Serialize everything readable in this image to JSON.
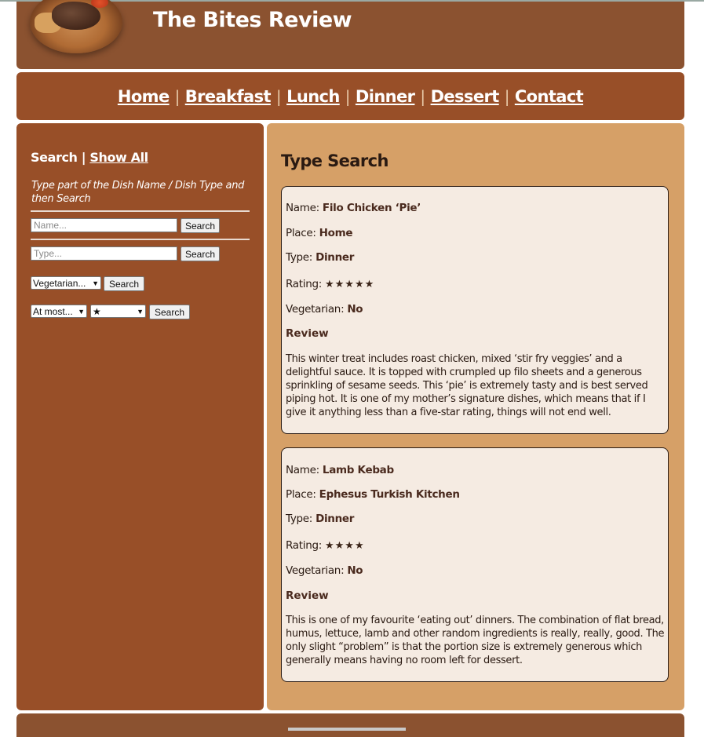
{
  "header": {
    "title": "The Bites Review",
    "logo_icon": "steak-dish-logo"
  },
  "nav": {
    "items": [
      "Home",
      "Breakfast",
      "Lunch",
      "Dinner",
      "Dessert",
      "Contact"
    ],
    "separator": "|"
  },
  "sidebar": {
    "search_label": "Search",
    "separator": "|",
    "show_all_label": "Show All",
    "help_text": "Type part of the Dish Name / Dish Type and then Search",
    "name_placeholder": "Name...",
    "type_placeholder": "Type...",
    "search_button": "Search",
    "vegetarian_select": "Vegetarian...",
    "rating_mode_select": "At most...",
    "rating_select": "★"
  },
  "main": {
    "title": "Type Search",
    "labels": {
      "name": "Name:",
      "place": "Place:",
      "type": "Type:",
      "rating": "Rating:",
      "vegetarian": "Vegetarian:",
      "review": "Review"
    },
    "reviews": [
      {
        "name": "Filo Chicken ‘Pie’",
        "place": "Home",
        "type": "Dinner",
        "rating": "★★★★★",
        "vegetarian": "No",
        "text": "This winter treat includes roast chicken, mixed ‘stir fry veggies’ and a delightful sauce. It is topped with crumpled up filo sheets and a generous sprinkling of sesame seeds. This ‘pie’ is extremely tasty and is best served piping hot. It is one of my mother’s signature dishes, which means that if I give it anything less than a five-star rating, things will not end well."
      },
      {
        "name": "Lamb Kebab",
        "place": "Ephesus Turkish Kitchen",
        "type": "Dinner",
        "rating": "★★★★",
        "vegetarian": "No",
        "text": "This is one of my favourite ‘eating out’ dinners. The combination of flat bread, humus, lettuce, lamb and other random ingredients is really, really, good. The only slight “problem” is that the portion size is extremely generous which generally means having no room left for dessert."
      }
    ]
  }
}
